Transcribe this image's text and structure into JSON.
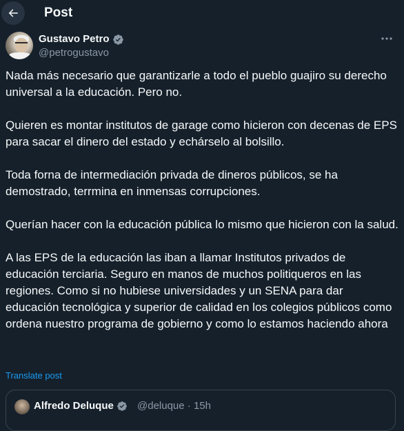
{
  "header": {
    "title": "Post",
    "back_icon": "arrow-left-icon"
  },
  "author": {
    "name": "Gustavo Petro",
    "handle": "@petrogustavo",
    "verified_icon": "verified-badge-icon",
    "more_icon": "more-horizontal-icon"
  },
  "post": {
    "paragraphs": [
      "Nada más necesario que garantizarle a todo el pueblo guajiro su derecho universal a la educación. Pero no.",
      "Quieren es montar institutos de garage como hicieron con decenas de EPS para sacar el dinero del estado y echárselo al bolsillo.",
      "Toda forna de intermediación privada de dineros públicos, se ha demostrado, terrmina en inmensas corrupciones.",
      "Querían hacer con la educación pública lo mismo que hicieron con la salud.",
      "A las EPS de la educación las iban a llamar Institutos privados de educación terciaria. Seguro en manos de muchos politiqueros en las regiones. Como si no hubiese universidades y un SENA para dar educación tecnológica y superior de calidad en los colegios públicos como ordena nuestro programa de gobierno y como lo estamos haciendo ahora"
    ],
    "translate_label": "Translate post"
  },
  "quote": {
    "name": "Alfredo Deluque",
    "meta": "@deluque · 15h"
  },
  "colors": {
    "background": "#15202b",
    "text": "#f7f9f9",
    "secondary_text": "#8b98a5",
    "accent": "#1d9bf0",
    "border": "#38444d"
  }
}
